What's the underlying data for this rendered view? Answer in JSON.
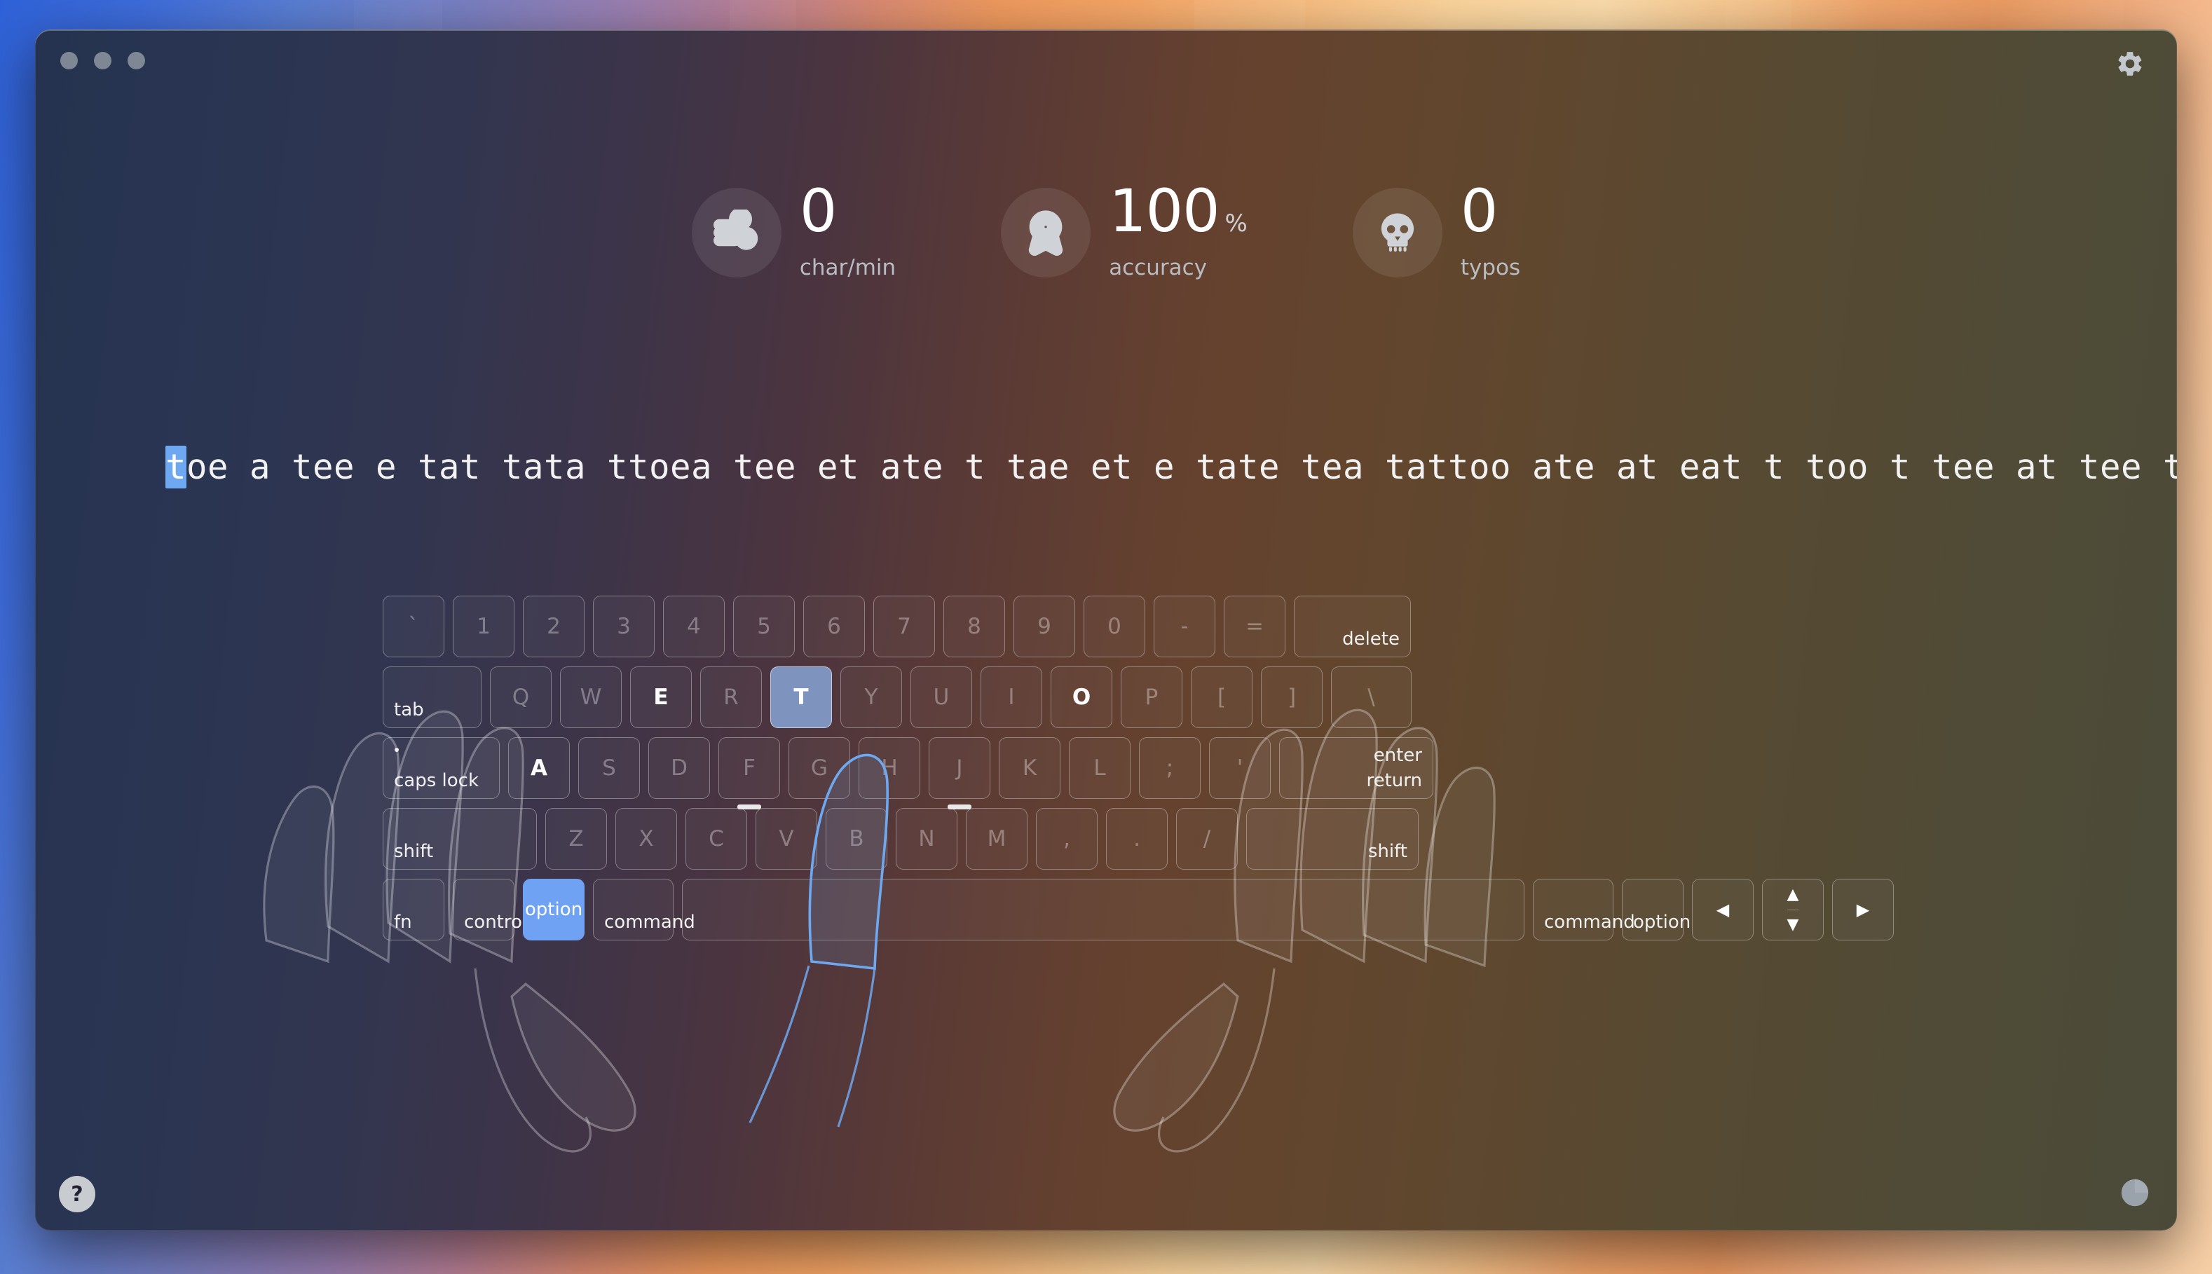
{
  "window": {
    "traffic_lights": [
      "close",
      "minimize",
      "maximize"
    ],
    "gear_label": "settings"
  },
  "stats": [
    {
      "icon": "wind-icon",
      "value": "0",
      "unit": "",
      "label": "char/min"
    },
    {
      "icon": "award-icon",
      "value": "100",
      "unit": "%",
      "label": "accuracy"
    },
    {
      "icon": "skull-icon",
      "value": "0",
      "unit": "",
      "label": "typos"
    }
  ],
  "typing": {
    "cursor_char": "t",
    "remaining_text": "oe a tee e tat tata ttoea tee et ate t tae et e tate tea tattoo ate at eat t too t tee at tee t too",
    "full_text": "toe a tee e tat tata ttoea tee et ate t tae et e tate tea tattoo ate at eat t too t tee at tee t too"
  },
  "keyboard": {
    "rows": [
      [
        {
          "name": "backtick",
          "center": "`",
          "w": "u1"
        },
        {
          "name": "1",
          "center": "1",
          "w": "u1"
        },
        {
          "name": "2",
          "center": "2",
          "w": "u1"
        },
        {
          "name": "3",
          "center": "3",
          "w": "u1"
        },
        {
          "name": "4",
          "center": "4",
          "w": "u1"
        },
        {
          "name": "5",
          "center": "5",
          "w": "u1"
        },
        {
          "name": "6",
          "center": "6",
          "w": "u1"
        },
        {
          "name": "7",
          "center": "7",
          "w": "u1"
        },
        {
          "name": "8",
          "center": "8",
          "w": "u1"
        },
        {
          "name": "9",
          "center": "9",
          "w": "u1"
        },
        {
          "name": "0",
          "center": "0",
          "w": "u1"
        },
        {
          "name": "minus",
          "center": "-",
          "w": "u1"
        },
        {
          "name": "equal",
          "center": "=",
          "w": "u1"
        },
        {
          "name": "delete",
          "br": "delete",
          "w": "u175"
        }
      ],
      [
        {
          "name": "tab",
          "bl": "tab",
          "w": "u15"
        },
        {
          "name": "q",
          "center": "Q",
          "w": "u1"
        },
        {
          "name": "w",
          "center": "W",
          "w": "u1"
        },
        {
          "name": "e",
          "center": "E",
          "w": "u1",
          "state": "bright"
        },
        {
          "name": "r",
          "center": "R",
          "w": "u1"
        },
        {
          "name": "t",
          "center": "T",
          "w": "u1",
          "state": "active"
        },
        {
          "name": "y",
          "center": "Y",
          "w": "u1"
        },
        {
          "name": "u",
          "center": "U",
          "w": "u1"
        },
        {
          "name": "i",
          "center": "I",
          "w": "u1"
        },
        {
          "name": "o",
          "center": "O",
          "w": "u1",
          "state": "bright"
        },
        {
          "name": "p",
          "center": "P",
          "w": "u1"
        },
        {
          "name": "bracket-left",
          "center": "[",
          "w": "u1"
        },
        {
          "name": "bracket-right",
          "center": "]",
          "w": "u1"
        },
        {
          "name": "backslash",
          "center": "\\",
          "w": "u125"
        }
      ],
      [
        {
          "name": "caps-lock",
          "bl": "caps lock",
          "dot": true,
          "w": "u175"
        },
        {
          "name": "a",
          "center": "A",
          "w": "u1",
          "state": "bright"
        },
        {
          "name": "s",
          "center": "S",
          "w": "u1"
        },
        {
          "name": "d",
          "center": "D",
          "w": "u1"
        },
        {
          "name": "f",
          "center": "F",
          "w": "u1",
          "home": true
        },
        {
          "name": "g",
          "center": "G",
          "w": "u1"
        },
        {
          "name": "h",
          "center": "H",
          "w": "u1"
        },
        {
          "name": "j",
          "center": "J",
          "w": "u1",
          "home": true
        },
        {
          "name": "k",
          "center": "K",
          "w": "u1"
        },
        {
          "name": "l",
          "center": "L",
          "w": "u1"
        },
        {
          "name": "semicolon",
          "center": ";",
          "w": "u1"
        },
        {
          "name": "quote",
          "center": "'",
          "w": "u1"
        },
        {
          "name": "enter-return",
          "tr": "enter",
          "br": "return",
          "w": "u225"
        }
      ],
      [
        {
          "name": "shift-left",
          "bl": "shift",
          "w": "u225"
        },
        {
          "name": "z",
          "center": "Z",
          "w": "u1"
        },
        {
          "name": "x",
          "center": "X",
          "w": "u1"
        },
        {
          "name": "c",
          "center": "C",
          "w": "u1"
        },
        {
          "name": "v",
          "center": "V",
          "w": "u1"
        },
        {
          "name": "b",
          "center": "B",
          "w": "u1"
        },
        {
          "name": "n",
          "center": "N",
          "w": "u1"
        },
        {
          "name": "m",
          "center": "M",
          "w": "u1"
        },
        {
          "name": "comma",
          "center": ",",
          "w": "u1"
        },
        {
          "name": "period",
          "center": ".",
          "w": "u1"
        },
        {
          "name": "slash",
          "center": "/",
          "w": "u1"
        },
        {
          "name": "shift-right",
          "br": "shift",
          "w": "u25"
        }
      ],
      [
        {
          "name": "fn",
          "bl": "fn",
          "w": "u1"
        },
        {
          "name": "control",
          "bl": "control",
          "w": "u1"
        },
        {
          "name": "option-left",
          "bl": "option",
          "w": "u1",
          "state": "pressed"
        },
        {
          "name": "command-left",
          "bl": "command",
          "w": "u125"
        },
        {
          "name": "space",
          "w": "space"
        },
        {
          "name": "command-right",
          "bl": "command",
          "w": "u125"
        },
        {
          "name": "option-right",
          "bl": "option",
          "w": "u1"
        },
        {
          "name": "arrow-left",
          "arrow": "◀",
          "w": "u1"
        },
        {
          "name": "arrow-updown",
          "arrow_up": "▲",
          "arrow_down": "▼",
          "w": "u1"
        },
        {
          "name": "arrow-right",
          "arrow": "▶",
          "w": "u1"
        }
      ]
    ]
  },
  "footer": {
    "help_label": "?",
    "chart_icon": "pie-chart-icon"
  },
  "colors": {
    "accent_pressed": "#6fa2f2",
    "accent_active": "#7e93bd",
    "cursor": "#6ea8f0",
    "text": "#f2f2f2",
    "key_dim": "rgba(255,255,255,.34)"
  }
}
